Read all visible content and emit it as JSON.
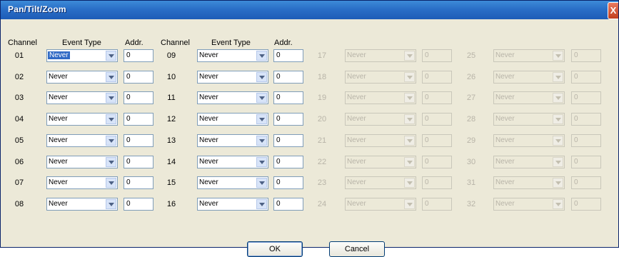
{
  "window": {
    "title": "Pan/Tilt/Zoom",
    "close_glyph": "X"
  },
  "headers": {
    "channel": "Channel",
    "event_type": "Event Type",
    "addr": "Addr."
  },
  "columns": [
    {
      "enabled": true,
      "rows": [
        {
          "channel": "01",
          "event_type": "Never",
          "addr": "0",
          "highlighted": true
        },
        {
          "channel": "02",
          "event_type": "Never",
          "addr": "0"
        },
        {
          "channel": "03",
          "event_type": "Never",
          "addr": "0"
        },
        {
          "channel": "04",
          "event_type": "Never",
          "addr": "0"
        },
        {
          "channel": "05",
          "event_type": "Never",
          "addr": "0"
        },
        {
          "channel": "06",
          "event_type": "Never",
          "addr": "0"
        },
        {
          "channel": "07",
          "event_type": "Never",
          "addr": "0"
        },
        {
          "channel": "08",
          "event_type": "Never",
          "addr": "0"
        }
      ]
    },
    {
      "enabled": true,
      "rows": [
        {
          "channel": "09",
          "event_type": "Never",
          "addr": "0"
        },
        {
          "channel": "10",
          "event_type": "Never",
          "addr": "0"
        },
        {
          "channel": "11",
          "event_type": "Never",
          "addr": "0"
        },
        {
          "channel": "12",
          "event_type": "Never",
          "addr": "0"
        },
        {
          "channel": "13",
          "event_type": "Never",
          "addr": "0"
        },
        {
          "channel": "14",
          "event_type": "Never",
          "addr": "0"
        },
        {
          "channel": "15",
          "event_type": "Never",
          "addr": "0"
        },
        {
          "channel": "16",
          "event_type": "Never",
          "addr": "0"
        }
      ]
    },
    {
      "enabled": false,
      "rows": [
        {
          "channel": "17",
          "event_type": "Never",
          "addr": "0"
        },
        {
          "channel": "18",
          "event_type": "Never",
          "addr": "0"
        },
        {
          "channel": "19",
          "event_type": "Never",
          "addr": "0"
        },
        {
          "channel": "20",
          "event_type": "Never",
          "addr": "0"
        },
        {
          "channel": "21",
          "event_type": "Never",
          "addr": "0"
        },
        {
          "channel": "22",
          "event_type": "Never",
          "addr": "0"
        },
        {
          "channel": "23",
          "event_type": "Never",
          "addr": "0"
        },
        {
          "channel": "24",
          "event_type": "Never",
          "addr": "0"
        }
      ]
    },
    {
      "enabled": false,
      "rows": [
        {
          "channel": "25",
          "event_type": "Never",
          "addr": "0"
        },
        {
          "channel": "26",
          "event_type": "Never",
          "addr": "0"
        },
        {
          "channel": "27",
          "event_type": "Never",
          "addr": "0"
        },
        {
          "channel": "28",
          "event_type": "Never",
          "addr": "0"
        },
        {
          "channel": "29",
          "event_type": "Never",
          "addr": "0"
        },
        {
          "channel": "30",
          "event_type": "Never",
          "addr": "0"
        },
        {
          "channel": "31",
          "event_type": "Never",
          "addr": "0"
        },
        {
          "channel": "32",
          "event_type": "Never",
          "addr": "0"
        }
      ]
    }
  ],
  "buttons": {
    "ok": "OK",
    "cancel": "Cancel"
  },
  "colors": {
    "title_bar": "#2a6fc7",
    "dialog_bg": "#ece9d8",
    "selection": "#316ac5",
    "disabled_text": "#b8b4a8"
  }
}
